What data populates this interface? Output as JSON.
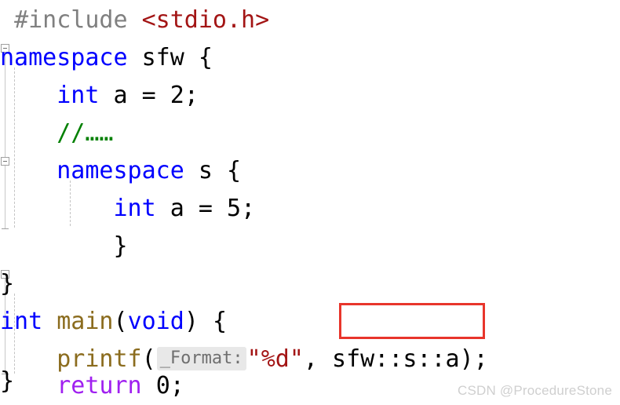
{
  "editor": {
    "language": "C++",
    "background_color": "#ffffff",
    "theme": "light",
    "colors": {
      "preprocessor": "#808080",
      "header": "#a31515",
      "keyword": "#0000ff",
      "identifier": "#000000",
      "comment": "#008000",
      "function": "#8b6c1e",
      "string": "#a31515",
      "control_keyword": "#a020f0",
      "hint_background": "#e8e8e8",
      "hint_text": "#6f6f6f",
      "annotation": "#e8352b",
      "indent_guide": "#c4c4c4",
      "watermark": "#cfcfcf"
    }
  },
  "code": {
    "lines": [
      {
        "index": 0,
        "indent": "",
        "tokens": [
          {
            "text": "#include",
            "type": "preprocessor"
          },
          {
            "text": " ",
            "type": "plain"
          },
          {
            "text": "<stdio.h>",
            "type": "header"
          }
        ]
      },
      {
        "index": 1,
        "indent": "",
        "tokens": [
          {
            "text": "namespace",
            "type": "keyword"
          },
          {
            "text": " ",
            "type": "plain"
          },
          {
            "text": "sfw",
            "type": "identifier"
          },
          {
            "text": " ",
            "type": "plain"
          },
          {
            "text": "{",
            "type": "punct"
          }
        ]
      },
      {
        "index": 2,
        "indent": "    ",
        "tokens": [
          {
            "text": "int",
            "type": "keyword"
          },
          {
            "text": " ",
            "type": "plain"
          },
          {
            "text": "a",
            "type": "identifier"
          },
          {
            "text": " = ",
            "type": "punct"
          },
          {
            "text": "2",
            "type": "number"
          },
          {
            "text": ";",
            "type": "punct"
          }
        ]
      },
      {
        "index": 3,
        "indent": "    ",
        "tokens": [
          {
            "text": "//……",
            "type": "comment"
          }
        ]
      },
      {
        "index": 4,
        "indent": "    ",
        "tokens": [
          {
            "text": "namespace",
            "type": "keyword"
          },
          {
            "text": " ",
            "type": "plain"
          },
          {
            "text": "s",
            "type": "identifier"
          },
          {
            "text": " ",
            "type": "plain"
          },
          {
            "text": "{",
            "type": "punct"
          }
        ]
      },
      {
        "index": 5,
        "indent": "        ",
        "tokens": [
          {
            "text": "int",
            "type": "keyword"
          },
          {
            "text": " ",
            "type": "plain"
          },
          {
            "text": "a",
            "type": "identifier"
          },
          {
            "text": " = ",
            "type": "punct"
          },
          {
            "text": "5",
            "type": "number"
          },
          {
            "text": ";",
            "type": "punct"
          }
        ]
      },
      {
        "index": 6,
        "indent": "    ",
        "tokens": [
          {
            "text": "}",
            "type": "punct"
          }
        ]
      },
      {
        "index": 7,
        "indent": "",
        "tokens": [
          {
            "text": "}",
            "type": "punct"
          }
        ]
      },
      {
        "index": 8,
        "indent": "",
        "tokens": [
          {
            "text": "int",
            "type": "keyword"
          },
          {
            "text": " ",
            "type": "plain"
          },
          {
            "text": "main",
            "type": "function"
          },
          {
            "text": "(",
            "type": "punct"
          },
          {
            "text": "void",
            "type": "keyword"
          },
          {
            "text": ") ",
            "type": "punct"
          },
          {
            "text": "{",
            "type": "punct"
          }
        ]
      },
      {
        "index": 9,
        "indent": "    ",
        "tokens": [
          {
            "text": "printf",
            "type": "function"
          },
          {
            "text": "(",
            "type": "punct"
          },
          {
            "text": "_Format:",
            "type": "hint"
          },
          {
            "text": "\"%d\"",
            "type": "string"
          },
          {
            "text": ", ",
            "type": "punct"
          },
          {
            "text": "sfw::s::a",
            "type": "identifier"
          },
          {
            "text": ");",
            "type": "punct"
          }
        ]
      },
      {
        "index": 10,
        "indent": "    ",
        "tokens": [
          {
            "text": "return",
            "type": "control_keyword"
          },
          {
            "text": " ",
            "type": "plain"
          },
          {
            "text": "0",
            "type": "number"
          },
          {
            "text": ";",
            "type": "punct"
          }
        ]
      },
      {
        "index": 11,
        "indent": "",
        "tokens": [
          {
            "text": "}",
            "type": "punct"
          }
        ]
      }
    ],
    "line_texts": {
      "l0": "#include <stdio.h>",
      "l1": "namespace sfw {",
      "l2": "    int a = 2;",
      "l3": "    //……",
      "l4": "    namespace s {",
      "l5": "        int a = 5;",
      "l6": "    }",
      "l7": "}",
      "l8": "int main(void) {",
      "l9": "    printf(_Format:\"%d\", sfw::s::a);",
      "l10": "    return 0;",
      "l11": "}"
    },
    "line0": {
      "include_directive": "#include",
      "header_name": "<stdio.h>"
    },
    "line1": {
      "keyword": "namespace",
      "name": "sfw",
      "brace": "{"
    },
    "line2": {
      "type": "int",
      "name": "a",
      "assign": " = ",
      "value": "2",
      "semicolon": ";"
    },
    "line3": {
      "comment": "//……"
    },
    "line4": {
      "keyword": "namespace",
      "name": "s",
      "brace": "{"
    },
    "line5": {
      "type": "int",
      "name": "a",
      "assign": " = ",
      "value": "5",
      "semicolon": ";"
    },
    "line6": {
      "brace": "}"
    },
    "line7": {
      "brace": "}"
    },
    "line8": {
      "return_type": "int",
      "function_name": "main",
      "open_paren": "(",
      "param": "void",
      "close_paren": ") ",
      "brace": "{"
    },
    "line9": {
      "function_name": "printf",
      "open_paren": "(",
      "param_hint": "_Format:",
      "format_string": "\"%d\"",
      "comma": ", ",
      "argument": "sfw::s::a",
      "close": ");"
    },
    "line10": {
      "keyword": "return",
      "value": "0",
      "semicolon": ";"
    },
    "line11": {
      "brace": "}"
    }
  },
  "annotations": [
    {
      "target": "sfw::s::a",
      "shape": "rectangle",
      "color": "#e8352b"
    }
  ],
  "gutter": {
    "fold_markers": [
      {
        "line": 1,
        "state": "expanded",
        "glyph": "minus-box"
      },
      {
        "line": 4,
        "state": "expanded",
        "glyph": "minus-box"
      },
      {
        "line": 8,
        "state": "expanded",
        "glyph": "minus-box"
      }
    ],
    "fold_ends": [
      {
        "line": 7
      },
      {
        "line": 11
      }
    ]
  },
  "watermark": {
    "text": "CSDN @ProcedureStone"
  }
}
